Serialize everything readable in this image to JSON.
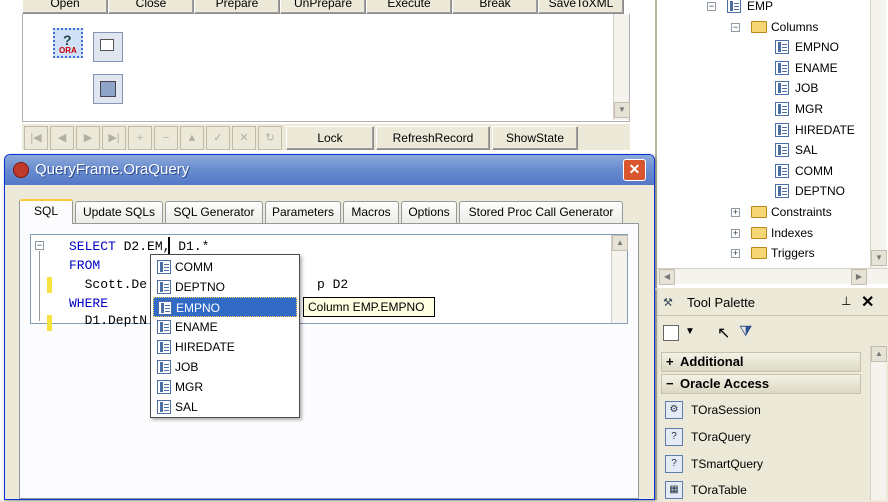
{
  "toolbar": {
    "buttons": [
      "Open",
      "Close",
      "Prepare",
      "UnPrepare",
      "Execute",
      "Break",
      "SaveToXML"
    ]
  },
  "nav_buttons": {
    "lock": "Lock",
    "refresh_record": "RefreshRecord",
    "show_state": "ShowState"
  },
  "tree": {
    "table": "EMP",
    "columns_folder": "Columns",
    "columns": [
      "EMPNO",
      "ENAME",
      "JOB",
      "MGR",
      "HIREDATE",
      "SAL",
      "COMM",
      "DEPTNO"
    ],
    "folders": [
      "Constraints",
      "Indexes",
      "Triggers"
    ]
  },
  "window": {
    "title": "QueryFrame.OraQuery",
    "tabs": [
      "SQL",
      "Update SQLs",
      "SQL Generator",
      "Parameters",
      "Macros",
      "Options",
      "Stored Proc Call Generator"
    ],
    "active_tab": "SQL"
  },
  "sql": {
    "line1_kw": "SELECT",
    "line1_rest": " D2.EM, D1.*",
    "line2_kw": "FROM",
    "line3a": "  Scott.De",
    "line3b": "p D2",
    "line4_kw": "WHERE",
    "line5": "  D1.DeptN"
  },
  "autocomplete": {
    "items": [
      "COMM",
      "DEPTNO",
      "EMPNO",
      "ENAME",
      "HIREDATE",
      "JOB",
      "MGR",
      "SAL"
    ],
    "selected": "EMPNO",
    "hint": "Column EMP.EMPNO"
  },
  "palette": {
    "title": "Tool Palette",
    "categories": [
      "Additional",
      "Oracle Access"
    ],
    "items": [
      "TOraSession",
      "TOraQuery",
      "TSmartQuery",
      "TOraTable"
    ]
  },
  "colors": {
    "title_bar": "#5478c8",
    "selection": "#316ac5",
    "keyword": "#0000c8",
    "hint_bg": "#ffffe1"
  }
}
